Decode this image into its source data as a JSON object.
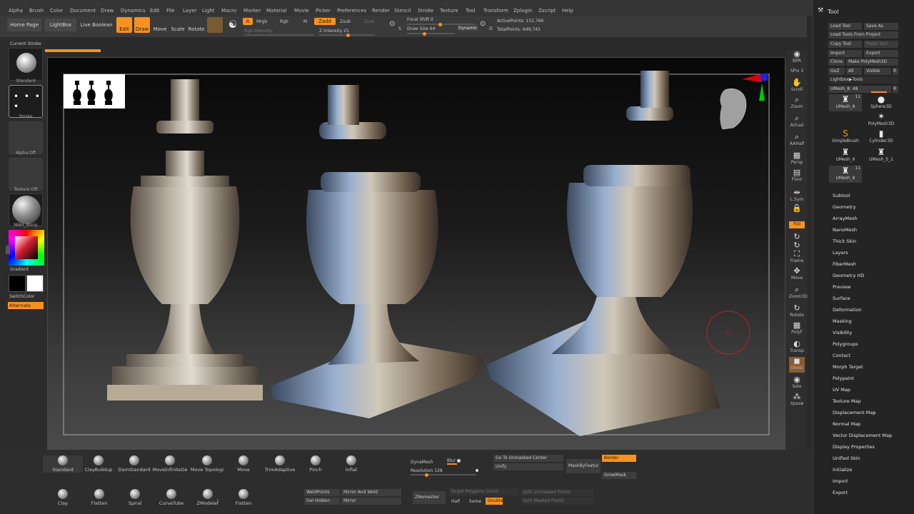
{
  "menu": [
    "Alpha",
    "Brush",
    "Color",
    "Document",
    "Draw",
    "Dynamics",
    "Edit",
    "File",
    "Layer",
    "Light",
    "Macro",
    "Marker",
    "Material",
    "Movie",
    "Picker",
    "Preferences",
    "Render",
    "Stencil",
    "Stroke",
    "Texture",
    "Tool",
    "Transform",
    "Zplugin",
    "Zscript",
    "Help"
  ],
  "top": {
    "home": "Home Page",
    "lightbox": "LightBox",
    "liveboolean": "Live Boolean",
    "edit": "Edit",
    "draw": "Draw",
    "move": "Move",
    "scale": "Scale",
    "rotate": "Rotate",
    "a": "A",
    "mrgb": "Mrgb",
    "rgb": "Rgb",
    "m": "M",
    "zadd": "Zadd",
    "zsub": "Zsub",
    "zcut": "Zcut",
    "rgb_intensity": "Rgb Intensity",
    "z_intensity": "Z Intensity 25",
    "focal_shift": "Focal Shift 0",
    "draw_size": "Draw Size 64",
    "dynamic": "Dynamic",
    "s_key": "S",
    "d_key": "D",
    "active_points": "ActivePoints: 151,766",
    "total_points": "TotalPoints: 649,745"
  },
  "left": {
    "current_stroke": "Current Stroke",
    "standard": "Standard",
    "stroke": "Stroke",
    "alpha_off": "Alpha Off",
    "texture_off": "Texture Off",
    "material": "MAH_Shiny",
    "gradient": "Gradient",
    "switchcolor": "SwitchColor",
    "alternate": "Alternate"
  },
  "rightbar": [
    {
      "name": "BPR",
      "label": "BPR",
      "icon": "◉"
    },
    {
      "name": "SPix",
      "label": "SPix 3",
      "icon": ""
    },
    {
      "name": "Scroll",
      "label": "Scroll",
      "icon": "✋"
    },
    {
      "name": "Zoom",
      "label": "Zoom",
      "icon": "⌕"
    },
    {
      "name": "Actual",
      "label": "Actual",
      "icon": "⌕"
    },
    {
      "name": "AAHalf",
      "label": "AAHalf",
      "icon": "⌕"
    },
    {
      "name": "Persp",
      "label": "Persp",
      "icon": "▦"
    },
    {
      "name": "Floor",
      "label": "Floor",
      "icon": "▤"
    },
    {
      "name": "LSym",
      "label": "L.Sym",
      "icon": "⇹"
    },
    {
      "name": "Lock",
      "label": "",
      "icon": "🔒"
    },
    {
      "name": "Xyz",
      "label": "Xyz",
      "icon": ""
    },
    {
      "name": "Rot1",
      "label": "",
      "icon": "↻"
    },
    {
      "name": "Rot2",
      "label": "",
      "icon": "↻"
    },
    {
      "name": "Frame",
      "label": "Frame",
      "icon": "⛶"
    },
    {
      "name": "Move",
      "label": "Move",
      "icon": "✥"
    },
    {
      "name": "Zoom3D",
      "label": "Zoom3D",
      "icon": "⌕"
    },
    {
      "name": "Rotate",
      "label": "Rotate",
      "icon": "↻"
    },
    {
      "name": "PolyF",
      "label": "PolyF",
      "icon": "▦"
    },
    {
      "name": "Transp",
      "label": "Transp",
      "icon": "◐"
    },
    {
      "name": "Ghost",
      "label": "Ghost",
      "icon": "◼"
    },
    {
      "name": "Solo",
      "label": "Solo",
      "icon": "◉"
    },
    {
      "name": "Xpose",
      "label": "Xpose",
      "icon": "⁂"
    }
  ],
  "toolpanel": {
    "title": "Tool",
    "load_tool": "Load Tool",
    "save_as": "Save As",
    "load_from_project": "Load Tools From Project",
    "copy_tool": "Copy Tool",
    "paste_tool": "Paste Tool",
    "import": "Import",
    "export": "Export",
    "clone": "Clone",
    "make_polymesh": "Make PolyMesh3D",
    "goz": "GoZ",
    "all": "All",
    "visible": "Visible",
    "r": "R",
    "lightbox_tools": "Lightbox▶Tools",
    "umesh_slider": "UMesh_8. 48",
    "r2": "R",
    "tools": [
      {
        "label": "UMesh_8",
        "icon": "♜",
        "count": "11"
      },
      {
        "label": "Sphere3D",
        "icon": "●",
        "count": ""
      },
      {
        "label": "",
        "icon": "",
        "count": ""
      },
      {
        "label": "PolyMesh3D",
        "icon": "✶",
        "count": ""
      },
      {
        "label": "SimpleBrush",
        "icon": "S",
        "count": ""
      },
      {
        "label": "Cylinder3D",
        "icon": "▮",
        "count": ""
      },
      {
        "label": "UMesh_6",
        "icon": "♜",
        "count": ""
      },
      {
        "label": "UMesh_5_1",
        "icon": "♜",
        "count": ""
      },
      {
        "label": "UMesh_8",
        "icon": "♜",
        "count": "11"
      }
    ],
    "sections": [
      "Subtool",
      "Geometry",
      "ArrayMesh",
      "NanoMesh",
      "Thick Skin",
      "Layers",
      "FiberMesh",
      "Geometry HD",
      "Preview",
      "Surface",
      "Deformation",
      "Masking",
      "Visibility",
      "Polygroups",
      "Contact",
      "Morph Target",
      "Polypaint",
      "UV Map",
      "Texture Map",
      "Displacement Map",
      "Normal Map",
      "Vector Displacement Map",
      "Display Properties",
      "Unified Skin",
      "Initialize",
      "Import",
      "Export"
    ]
  },
  "bottom": {
    "brushes_row1": [
      "Standard",
      "ClayBuildup",
      "DamStandard",
      "MoveInfiniteDe",
      "Move Topologi",
      "Move",
      "TrimAdaptive",
      "Pinch",
      "Inflat"
    ],
    "brushes_row2": [
      "Clay",
      "Flatten",
      "Spiral",
      "CurveTube",
      "ZModeler",
      "Flatten"
    ],
    "zmodeler_count": "1",
    "dynamesh": "DynaMesh",
    "blur": "Blur",
    "resolution": "Resolution 128",
    "go_unmasked": "Go To Unmasked Center",
    "unify": "Unify",
    "maskbyfeature": "MaskByFeatur",
    "border": "Border",
    "growmask": "GrowMask",
    "weldpoints": "WeldPoints",
    "mirror_weld": "Mirror And Weld",
    "del_hidden": "Del Hidden",
    "mirror": "Mirror",
    "zremesher": "ZRemesher",
    "target_poly": "Target Polygons Count",
    "half": "Half",
    "same": "Same",
    "double": "Double",
    "split_unmasked": "Split Unmasked Points",
    "split_masked": "Split Masked Points"
  },
  "colors": {
    "accent": "#f7921e",
    "viewport_top": "#080808",
    "viewport_bottom": "#4a4a4a"
  }
}
